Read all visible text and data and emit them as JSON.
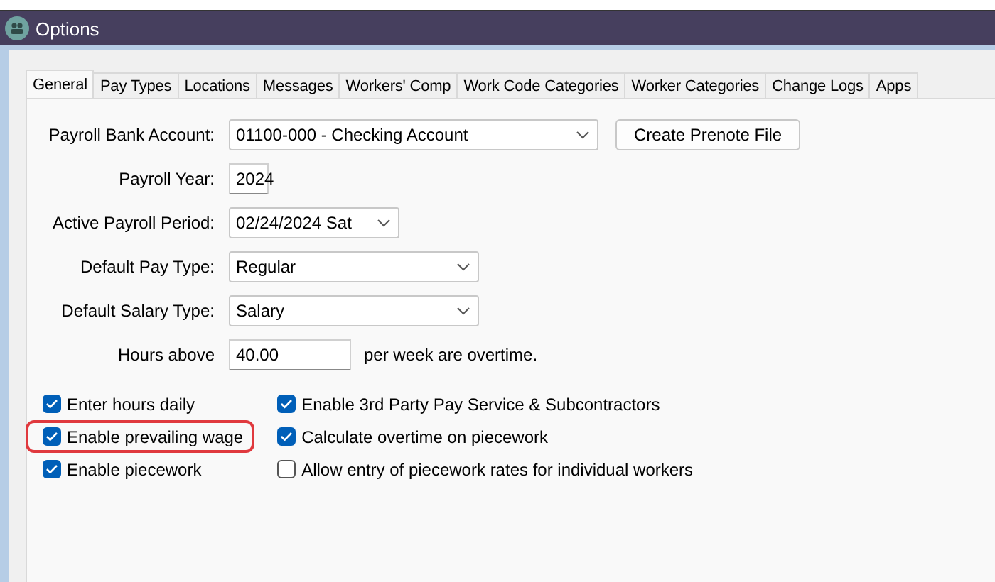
{
  "window": {
    "title": "Options"
  },
  "tabs": [
    {
      "label": "General",
      "selected": true
    },
    {
      "label": "Pay Types",
      "selected": false
    },
    {
      "label": "Locations",
      "selected": false
    },
    {
      "label": "Messages",
      "selected": false
    },
    {
      "label": "Workers' Comp",
      "selected": false
    },
    {
      "label": "Work Code Categories",
      "selected": false
    },
    {
      "label": "Worker Categories",
      "selected": false
    },
    {
      "label": "Change Logs",
      "selected": false
    },
    {
      "label": "Apps",
      "selected": false
    }
  ],
  "fields": [
    {
      "label": "Payroll Bank Account:",
      "kind": "dropdown",
      "value": "01100-000 - Checking Account",
      "button": "Create Prenote File"
    },
    {
      "label": "Payroll Year:",
      "kind": "spin",
      "value": "2024"
    },
    {
      "label": "Active Payroll Period:",
      "kind": "dropdown",
      "value": "02/24/2024 Sat"
    },
    {
      "label": "Default Pay Type:",
      "kind": "dropdown",
      "value": "Regular"
    },
    {
      "label": "Default Salary Type:",
      "kind": "dropdown",
      "value": "Salary"
    },
    {
      "label": "Hours above",
      "kind": "text",
      "value": "40.00",
      "suffix": "per week are overtime."
    }
  ],
  "checkbox_columns": [
    [
      {
        "label": "Enter hours daily",
        "checked": true,
        "highlighted": false
      },
      {
        "label": "Enable prevailing wage",
        "checked": true,
        "highlighted": true
      },
      {
        "label": "Enable piecework",
        "checked": true,
        "highlighted": false
      }
    ],
    [
      {
        "label": "Enable 3rd Party Pay Service & Subcontractors",
        "checked": true,
        "highlighted": false
      },
      {
        "label": "Calculate overtime on piecework",
        "checked": true,
        "highlighted": false
      },
      {
        "label": "Allow entry of piecework rates for individual workers",
        "checked": false,
        "highlighted": false
      }
    ]
  ]
}
